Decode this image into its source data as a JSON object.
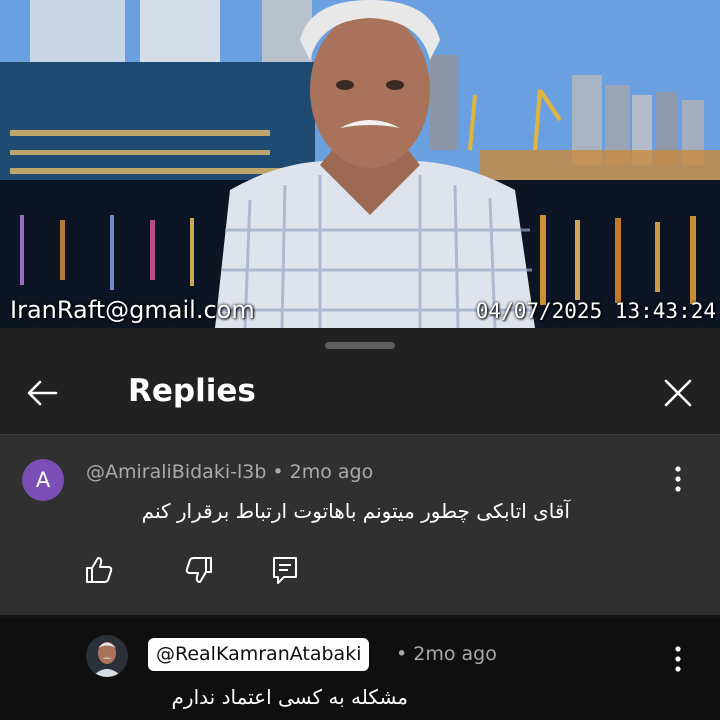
{
  "video": {
    "watermark": "IranRaft@gmail.com",
    "timestamp": "04/07/2025 13:43:24"
  },
  "sheet": {
    "title": "Replies",
    "back_icon": "arrow-left-icon",
    "close_icon": "close-icon"
  },
  "comment": {
    "avatar_letter": "A",
    "author": "@AmiraliBidaki-l3b",
    "separator": "•",
    "time": "2mo ago",
    "text": "آقای اتابکی چطور میتونم باهاتوت ارتباط برقرار کنم",
    "actions": [
      "thumbs-up-icon",
      "thumbs-down-icon",
      "reply-icon"
    ],
    "menu_icon": "more-vert-icon"
  },
  "reply": {
    "author": "@RealKamranAtabaki",
    "separator": "•",
    "time": "2mo ago",
    "text": "مشکله به کسی اعتماد ندارم",
    "menu_icon": "more-vert-icon"
  },
  "colors": {
    "sheet_bg": "#212121",
    "comment_bg": "#303030",
    "reply_bg": "#0f0f0f",
    "avatar_bg": "#7b4fb5",
    "meta_text": "#aaaaaa"
  }
}
